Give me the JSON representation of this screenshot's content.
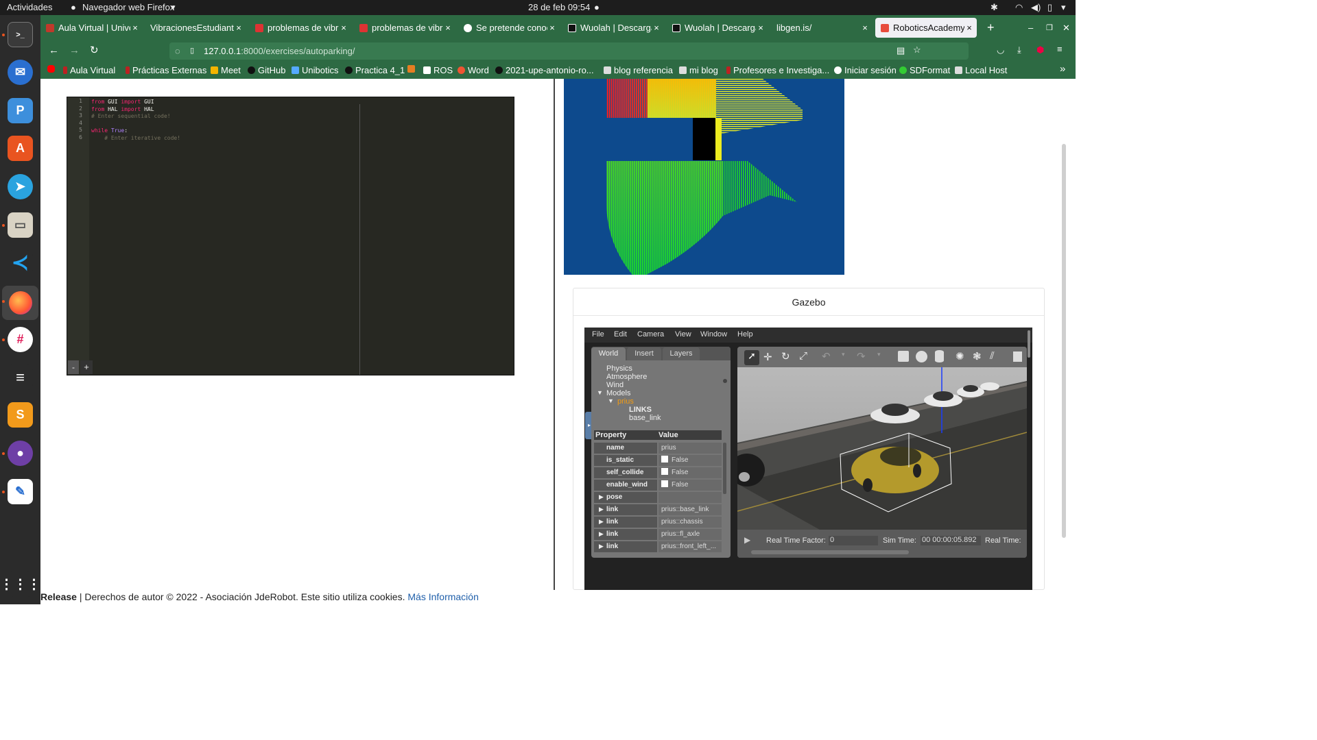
{
  "system": {
    "activities": "Actividades",
    "app_name": "Navegador web Firefox",
    "datetime": "28 de feb  09:54"
  },
  "tabs": [
    {
      "label": "Aula Virtual | Unive",
      "color": "#c0392b"
    },
    {
      "label": "VibracionesEstudiante",
      "color": "#2d6a43"
    },
    {
      "label": "problemas de vibra",
      "color": "#d33"
    },
    {
      "label": "problemas de vibra",
      "color": "#d33"
    },
    {
      "label": "Se pretende conoc",
      "color": "#fff"
    },
    {
      "label": "Wuolah | Descarga",
      "color": "#111"
    },
    {
      "label": "Wuolah | Descarga",
      "color": "#111"
    },
    {
      "label": "libgen.is/",
      "color": "#2d6a43"
    },
    {
      "label": "RoboticsAcademy",
      "color": "#e74c3c"
    }
  ],
  "address_bar": {
    "host": "127.0.0.1",
    "path": ":8000/exercises/autoparking/"
  },
  "bookmarks": [
    "Aula Virtual",
    "Prácticas Externas",
    "Meet",
    "GitHub",
    "Unibotics",
    "Practica 4_1",
    "ROS",
    "Word",
    "2021-upe-antonio-ro...",
    "blog referencia",
    "mi blog",
    "Profesores e Investiga...",
    "Iniciar sesión",
    "SDFormat",
    "Local Host"
  ],
  "editor": {
    "line_numbers": [
      "1",
      "2",
      "3",
      "4",
      "5",
      "6"
    ],
    "lines": [
      [
        {
          "t": "from",
          "c": "#f92672"
        },
        {
          "t": " GUI ",
          "c": "#f8f8f2"
        },
        {
          "t": "import",
          "c": "#f92672"
        },
        {
          "t": " GUI",
          "c": "#f8f8f2"
        }
      ],
      [
        {
          "t": "from",
          "c": "#f92672"
        },
        {
          "t": " HAL ",
          "c": "#f8f8f2"
        },
        {
          "t": "import",
          "c": "#f92672"
        },
        {
          "t": " HAL",
          "c": "#f8f8f2"
        }
      ],
      [
        {
          "t": "# Enter sequential code!",
          "c": "#75715e"
        }
      ],
      [],
      [
        {
          "t": "while",
          "c": "#f92672"
        },
        {
          "t": " True",
          "c": "#ae81ff"
        },
        {
          "t": ":",
          "c": "#f8f8f2"
        }
      ],
      [
        {
          "t": "    # Enter iterative code!",
          "c": "#75715e"
        }
      ]
    ],
    "zoom_out": "-",
    "zoom_in": "+"
  },
  "gazebo": {
    "card_title": "Gazebo",
    "menu": [
      "File",
      "Edit",
      "Camera",
      "View",
      "Window",
      "Help"
    ],
    "left_tabs": [
      "World",
      "Insert",
      "Layers"
    ],
    "tree": [
      "Physics",
      "Atmosphere",
      "Wind",
      "Models",
      "prius",
      "LINKS",
      "base_link"
    ],
    "prop_header": [
      "Property",
      "Value"
    ],
    "props": [
      {
        "k": "name",
        "v": "prius"
      },
      {
        "k": "is_static",
        "v": "False"
      },
      {
        "k": "self_collide",
        "v": "False"
      },
      {
        "k": "enable_wind",
        "v": "False"
      },
      {
        "k": "pose",
        "v": ""
      },
      {
        "k": "link",
        "v": "prius::base_link"
      },
      {
        "k": "link",
        "v": "prius::chassis"
      },
      {
        "k": "link",
        "v": "prius::fl_axle"
      },
      {
        "k": "link",
        "v": "prius::front_left_..."
      }
    ],
    "rtf_label": "Real Time Factor:",
    "rtf_value": "0",
    "sim_label": "Sim Time:",
    "sim_value": "00 00:00:05.892",
    "real_label": "Real Time:"
  },
  "footer": {
    "bold": "Release",
    "text": " | Derechos de autor © 2022 - Asociación JdeRobot. Este sitio utiliza cookies. ",
    "link": "Más Información"
  }
}
